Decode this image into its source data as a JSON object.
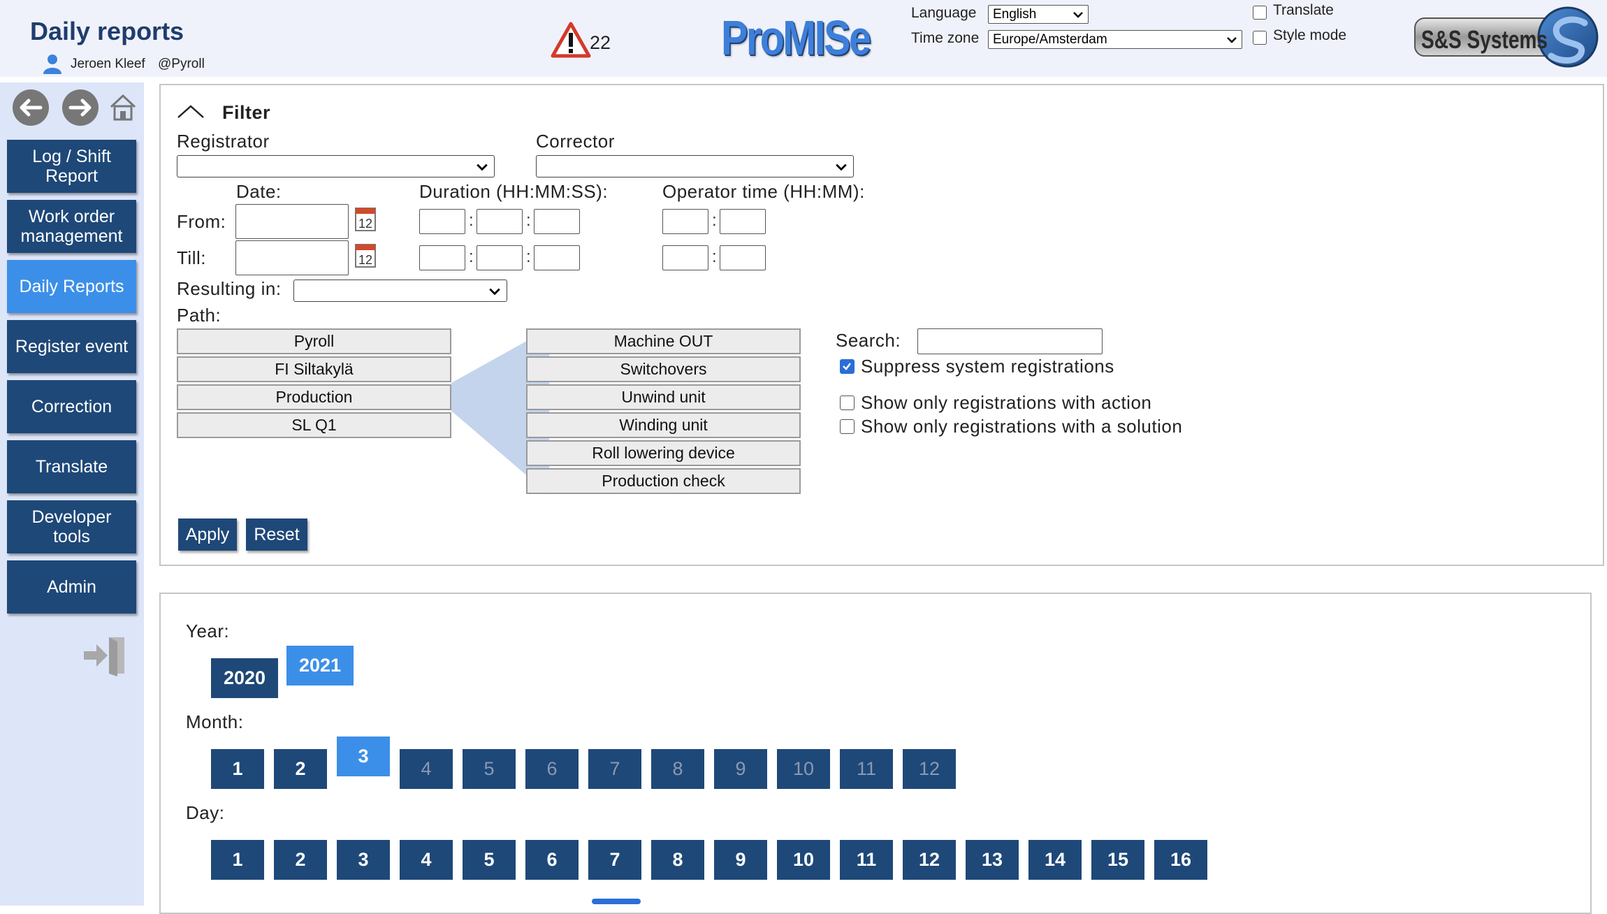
{
  "header": {
    "title": "Daily reports",
    "user_name": "Jeroen Kleef",
    "user_org": "@Pyroll",
    "alert_count": "22",
    "logo_text": "ProMISe",
    "language_label": "Language",
    "language_value": "English",
    "timezone_label": "Time zone",
    "timezone_value": "Europe/Amsterdam",
    "translate_label": "Translate",
    "style_mode_label": "Style mode",
    "vendor_logo_text": "S&S Systems"
  },
  "sidebar": {
    "items": [
      {
        "label": "Log / Shift Report"
      },
      {
        "label": "Work order management"
      },
      {
        "label": "Daily Reports",
        "active": true
      },
      {
        "label": "Register event"
      },
      {
        "label": "Correction"
      },
      {
        "label": "Translate"
      },
      {
        "label": "Developer tools"
      },
      {
        "label": "Admin"
      }
    ]
  },
  "filter": {
    "title": "Filter",
    "registrator_label": "Registrator",
    "corrector_label": "Corrector",
    "date_label": "Date:",
    "duration_label": "Duration (HH:MM:SS):",
    "operator_time_label": "Operator time (HH:MM):",
    "from_label": "From:",
    "till_label": "Till:",
    "calendar_day": "12",
    "resulting_in_label": "Resulting in:",
    "path_label": "Path:",
    "path_left": [
      "Pyroll",
      "FI Siltakylä",
      "Production",
      "SL Q1"
    ],
    "path_right": [
      "Machine OUT",
      "Switchovers",
      "Unwind unit",
      "Winding unit",
      "Roll lowering device",
      "Production check"
    ],
    "search_label": "Search:",
    "suppress_label": "Suppress system registrations",
    "suppress_checked": true,
    "only_action_label": "Show only registrations with action",
    "only_solution_label": "Show only registrations with a solution",
    "apply_label": "Apply",
    "reset_label": "Reset"
  },
  "dates": {
    "year_label": "Year:",
    "years": [
      "2020",
      "2021"
    ],
    "active_year": "2021",
    "month_label": "Month:",
    "months": [
      "1",
      "2",
      "3",
      "4",
      "5",
      "6",
      "7",
      "8",
      "9",
      "10",
      "11",
      "12"
    ],
    "active_month": "3",
    "day_label": "Day:",
    "days": [
      "1",
      "2",
      "3",
      "4",
      "5",
      "6",
      "7",
      "8",
      "9",
      "10",
      "11",
      "12",
      "13",
      "14",
      "15",
      "16"
    ]
  },
  "colors": {
    "primary": "#1e4878",
    "active": "#3c8fe8",
    "sidebar_bg": "#dde5f9",
    "header_bg": "#f0f2fb",
    "title": "#1f3d6d"
  }
}
